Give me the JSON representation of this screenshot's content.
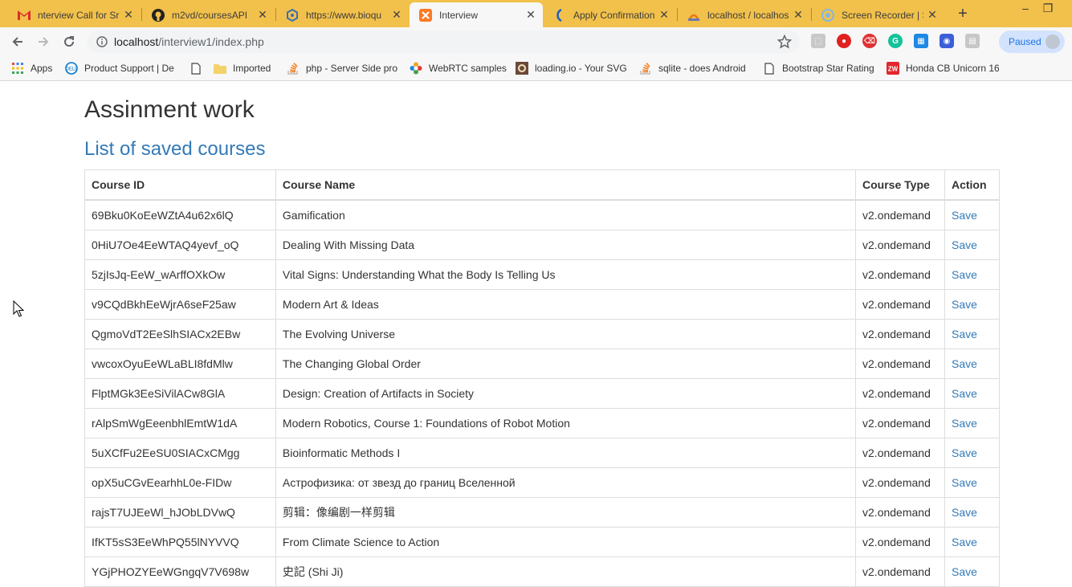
{
  "browser": {
    "tabs": [
      {
        "title": "nterview Call for Sr",
        "icon": "gmail-icon",
        "active": false
      },
      {
        "title": "m2vd/coursesAPI",
        "icon": "github-icon",
        "active": false
      },
      {
        "title": "https://www.bioqu",
        "icon": "hexagon-icon",
        "active": false
      },
      {
        "title": "Interview",
        "icon": "xampp-icon",
        "active": true
      },
      {
        "title": "Apply Confirmation",
        "icon": "k-logo-icon",
        "active": false
      },
      {
        "title": "localhost / localhos",
        "icon": "phpmyadmin-icon",
        "active": false
      },
      {
        "title": "Screen Recorder | S",
        "icon": "record-icon",
        "active": false
      }
    ],
    "url_host": "localhost",
    "url_path": "/interview1/index.php",
    "profile_status": "Paused",
    "bookmarks": [
      {
        "label": "Apps",
        "icon": "apps-grid-icon"
      },
      {
        "label": "Product Support | De",
        "icon": "dell-icon"
      },
      {
        "label": "",
        "icon": "page-icon"
      },
      {
        "label": "Imported",
        "icon": "folder-icon"
      },
      {
        "label": "php - Server Side pro",
        "icon": "stackoverflow-icon"
      },
      {
        "label": "WebRTC samples",
        "icon": "webrtc-icon"
      },
      {
        "label": "loading.io - Your SVG",
        "icon": "loadingio-icon"
      },
      {
        "label": "sqlite - does Android",
        "icon": "stackoverflow-icon"
      },
      {
        "label": "Bootstrap Star Rating",
        "icon": "page-icon"
      },
      {
        "label": "Honda CB Unicorn 16",
        "icon": "zigwheels-icon"
      }
    ],
    "colors": {
      "tabstrip": "#f2c14b",
      "toolbar": "#f7f7f7",
      "link": "#337ab7"
    }
  },
  "page": {
    "title": "Assinment work",
    "subtitle": "List of saved courses",
    "table": {
      "headers": [
        "Course ID",
        "Course Name",
        "Course Type",
        "Action"
      ],
      "rows": [
        [
          "69Bku0KoEeWZtA4u62x6lQ",
          "Gamification",
          "v2.ondemand",
          "Save"
        ],
        [
          "0HiU7Oe4EeWTAQ4yevf_oQ",
          "Dealing With Missing Data",
          "v2.ondemand",
          "Save"
        ],
        [
          "5zjIsJq-EeW_wArffOXkOw",
          "Vital Signs: Understanding What the Body Is Telling Us",
          "v2.ondemand",
          "Save"
        ],
        [
          "v9CQdBkhEeWjrA6seF25aw",
          "Modern Art & Ideas",
          "v2.ondemand",
          "Save"
        ],
        [
          "QgmoVdT2EeSlhSIACx2EBw",
          "The Evolving Universe",
          "v2.ondemand",
          "Save"
        ],
        [
          "vwcoxOyuEeWLaBLI8fdMlw",
          "The Changing Global Order",
          "v2.ondemand",
          "Save"
        ],
        [
          "FlptMGk3EeSiVilACw8GlA",
          "Design: Creation of Artifacts in Society",
          "v2.ondemand",
          "Save"
        ],
        [
          "rAlpSmWgEeenbhlEmtW1dA",
          "Modern Robotics, Course 1: Foundations of Robot Motion",
          "v2.ondemand",
          "Save"
        ],
        [
          "5uXCfFu2EeSU0SIACxCMgg",
          "Bioinformatic Methods I",
          "v2.ondemand",
          "Save"
        ],
        [
          "opX5uCGvEearhhL0e-FIDw",
          "Астрофизика: от звезд до границ Вселенной",
          "v2.ondemand",
          "Save"
        ],
        [
          "rajsT7UJEeWl_hJObLDVwQ",
          "剪辑：像编剧一样剪辑",
          "v2.ondemand",
          "Save"
        ],
        [
          "IfKT5sS3EeWhPQ55lNYVVQ",
          "From Climate Science to Action",
          "v2.ondemand",
          "Save"
        ],
        [
          "YGjPHOZYEeWGngqV7V698w",
          "史記 (Shi Ji)",
          "v2.ondemand",
          "Save"
        ]
      ]
    }
  }
}
